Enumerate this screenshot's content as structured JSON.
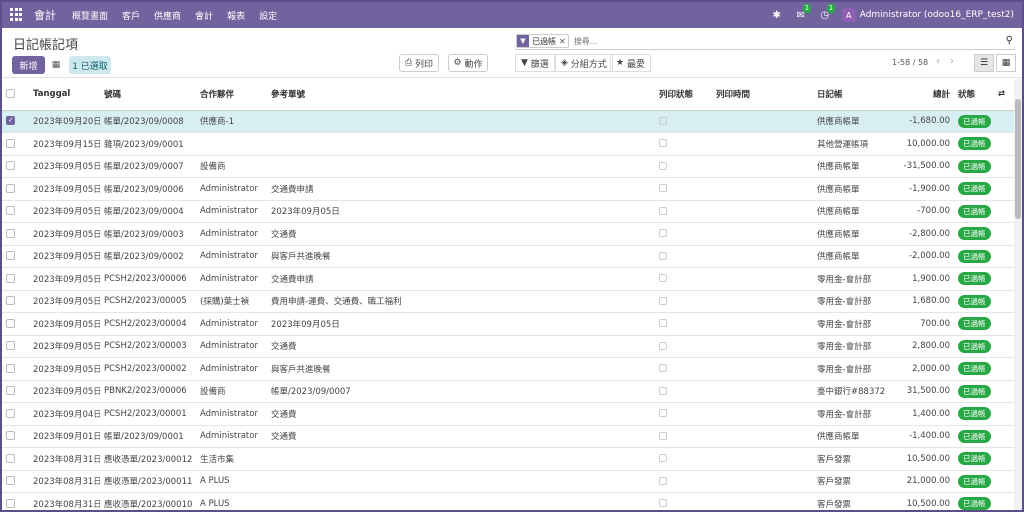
{
  "navbar": {
    "brand": "會計",
    "menus": [
      "概覽畫面",
      "客戶",
      "供應商",
      "會計",
      "報表",
      "設定"
    ],
    "chat_count": "1",
    "activity_count": "1",
    "avatar_letter": "A",
    "user": "Administrator (odoo16_ERP_test2)"
  },
  "control": {
    "title": "日記帳記項",
    "new_label": "新增",
    "selected_label": "1 已選取",
    "print_label": "列印",
    "action_label": "動作",
    "facet_label": "已過帳",
    "search_placeholder": "搜尋...",
    "filter_label": "篩選",
    "groupby_label": "分組方式",
    "fav_label": "最愛",
    "pager": "1-58 / 58"
  },
  "table": {
    "headers": {
      "date": "Tanggal",
      "number": "號碼",
      "partner": "合作夥伴",
      "ref": "參考單號",
      "print_status": "列印狀態",
      "print_time": "列印時間",
      "journal": "日記帳",
      "total": "總計",
      "state": "狀態"
    },
    "rows": [
      {
        "selected": true,
        "date": "2023年09月20日",
        "number": "帳單/2023/09/0008",
        "partner": "供應商-1",
        "ref": "",
        "journal": "供應商帳單",
        "total": "-1,680.00",
        "state": "已過帳"
      },
      {
        "selected": false,
        "date": "2023年09月15日",
        "number": "雜項/2023/09/0001",
        "partner": "",
        "ref": "",
        "journal": "其他營運帳項",
        "total": "10,000.00",
        "state": "已過帳"
      },
      {
        "selected": false,
        "date": "2023年09月05日",
        "number": "帳單/2023/09/0007",
        "partner": "設備商",
        "ref": "",
        "journal": "供應商帳單",
        "total": "-31,500.00",
        "state": "已過帳"
      },
      {
        "selected": false,
        "date": "2023年09月05日",
        "number": "帳單/2023/09/0006",
        "partner": "Administrator",
        "ref": "交通費申請",
        "journal": "供應商帳單",
        "total": "-1,900.00",
        "state": "已過帳"
      },
      {
        "selected": false,
        "date": "2023年09月05日",
        "number": "帳單/2023/09/0004",
        "partner": "Administrator",
        "ref": "2023年09月05日",
        "journal": "供應商帳單",
        "total": "-700.00",
        "state": "已過帳"
      },
      {
        "selected": false,
        "date": "2023年09月05日",
        "number": "帳單/2023/09/0003",
        "partner": "Administrator",
        "ref": "交通費",
        "journal": "供應商帳單",
        "total": "-2,800.00",
        "state": "已過帳"
      },
      {
        "selected": false,
        "date": "2023年09月05日",
        "number": "帳單/2023/09/0002",
        "partner": "Administrator",
        "ref": "與客戶共進晚餐",
        "journal": "供應商帳單",
        "total": "-2,000.00",
        "state": "已過帳"
      },
      {
        "selected": false,
        "date": "2023年09月05日",
        "number": "PCSH2/2023/00006",
        "partner": "Administrator",
        "ref": "交通費申請",
        "journal": "零用金-會計部",
        "total": "1,900.00",
        "state": "已過帳"
      },
      {
        "selected": false,
        "date": "2023年09月05日",
        "number": "PCSH2/2023/00005",
        "partner": "(採購)葉士禎",
        "ref": "費用申請-運費、交通費、職工福利",
        "journal": "零用金-會計部",
        "total": "1,680.00",
        "state": "已過帳"
      },
      {
        "selected": false,
        "date": "2023年09月05日",
        "number": "PCSH2/2023/00004",
        "partner": "Administrator",
        "ref": "2023年09月05日",
        "journal": "零用金-會計部",
        "total": "700.00",
        "state": "已過帳"
      },
      {
        "selected": false,
        "date": "2023年09月05日",
        "number": "PCSH2/2023/00003",
        "partner": "Administrator",
        "ref": "交通費",
        "journal": "零用金-會計部",
        "total": "2,800.00",
        "state": "已過帳"
      },
      {
        "selected": false,
        "date": "2023年09月05日",
        "number": "PCSH2/2023/00002",
        "partner": "Administrator",
        "ref": "與客戶共進晚餐",
        "journal": "零用金-會計部",
        "total": "2,000.00",
        "state": "已過帳"
      },
      {
        "selected": false,
        "date": "2023年09月05日",
        "number": "PBNK2/2023/00006",
        "partner": "設備商",
        "ref": "帳單/2023/09/0007",
        "journal": "臺中銀行#88372",
        "total": "31,500.00",
        "state": "已過帳"
      },
      {
        "selected": false,
        "date": "2023年09月04日",
        "number": "PCSH2/2023/00001",
        "partner": "Administrator",
        "ref": "交通費",
        "journal": "零用金-會計部",
        "total": "1,400.00",
        "state": "已過帳"
      },
      {
        "selected": false,
        "date": "2023年09月01日",
        "number": "帳單/2023/09/0001",
        "partner": "Administrator",
        "ref": "交通費",
        "journal": "供應商帳單",
        "total": "-1,400.00",
        "state": "已過帳"
      },
      {
        "selected": false,
        "date": "2023年08月31日",
        "number": "應收憑單/2023/00012",
        "partner": "生活市集",
        "ref": "",
        "journal": "客戶發票",
        "total": "10,500.00",
        "state": "已過帳"
      },
      {
        "selected": false,
        "date": "2023年08月31日",
        "number": "應收憑單/2023/00011",
        "partner": "A PLUS",
        "ref": "",
        "journal": "客戶發票",
        "total": "21,000.00",
        "state": "已過帳"
      },
      {
        "selected": false,
        "date": "2023年08月31日",
        "number": "應收憑單/2023/00010",
        "partner": "A PLUS",
        "ref": "",
        "journal": "客戶發票",
        "total": "10,500.00",
        "state": "已過帳"
      }
    ]
  }
}
